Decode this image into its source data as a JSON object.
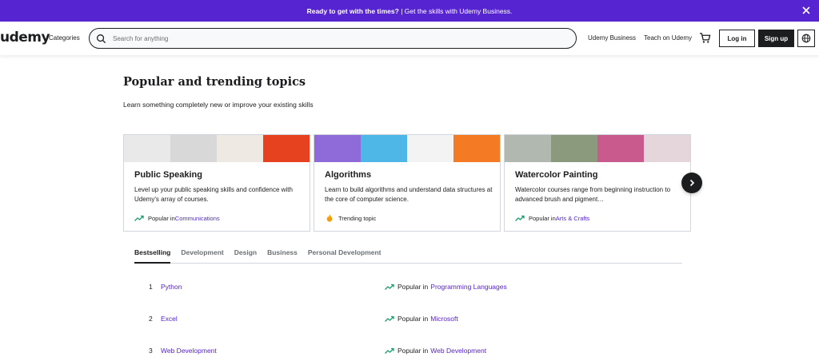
{
  "banner": {
    "bold_text": "Ready to get with the times?",
    "text": " | Get the skills with Udemy Business."
  },
  "header": {
    "logo": "udemy",
    "categories": "Categories",
    "search_placeholder": "Search for anything",
    "udemy_business": "Udemy Business",
    "teach": "Teach on Udemy",
    "login": "Log in",
    "signup": "Sign up"
  },
  "section": {
    "title": "Popular and trending topics",
    "subtitle": "Learn something completely new or improve your existing skills"
  },
  "cards": [
    {
      "title": "Public Speaking",
      "description": "Level up your public speaking skills and confidence with Udemy's array of courses.",
      "foot_prefix": "Popular in ",
      "foot_link": "Communications",
      "foot_icon": "trending-icon",
      "thumb_colors": [
        "#e9e9e9",
        "#d8d8d8",
        "#efe9e4",
        "#e7421f"
      ]
    },
    {
      "title": "Algorithms",
      "description": "Learn to build algorithms and understand data structures at the core of computer science.",
      "foot_prefix": "Trending topic",
      "foot_link": "",
      "foot_icon": "flame-icon",
      "thumb_colors": [
        "#8e6bd9",
        "#4fb6e8",
        "#f3f3f3",
        "#f57a24"
      ]
    },
    {
      "title": "Watercolor Painting",
      "description": "Watercolor courses range from beginning instruction to advanced brush and pigment…",
      "foot_prefix": "Popular in ",
      "foot_link": "Arts & Crafts",
      "foot_icon": "trending-icon",
      "thumb_colors": [
        "#b0b8b0",
        "#8b9a7c",
        "#c85a8e",
        "#e4d6da"
      ]
    }
  ],
  "tabs": [
    "Bestselling",
    "Development",
    "Design",
    "Business",
    "Personal Development"
  ],
  "active_tab": "Bestselling",
  "rows": [
    {
      "num": "1",
      "name": "Python",
      "pop": "Popular in",
      "category": "Programming Languages"
    },
    {
      "num": "2",
      "name": "Excel",
      "pop": "Popular in",
      "category": "Microsoft"
    },
    {
      "num": "3",
      "name": "Web Development",
      "pop": "Popular in",
      "category": "Web Development"
    }
  ],
  "colors": {
    "brand": "#5624d0",
    "text": "#1c1d1f",
    "trend": "#1e9e6a",
    "flame": "#f69c08"
  }
}
